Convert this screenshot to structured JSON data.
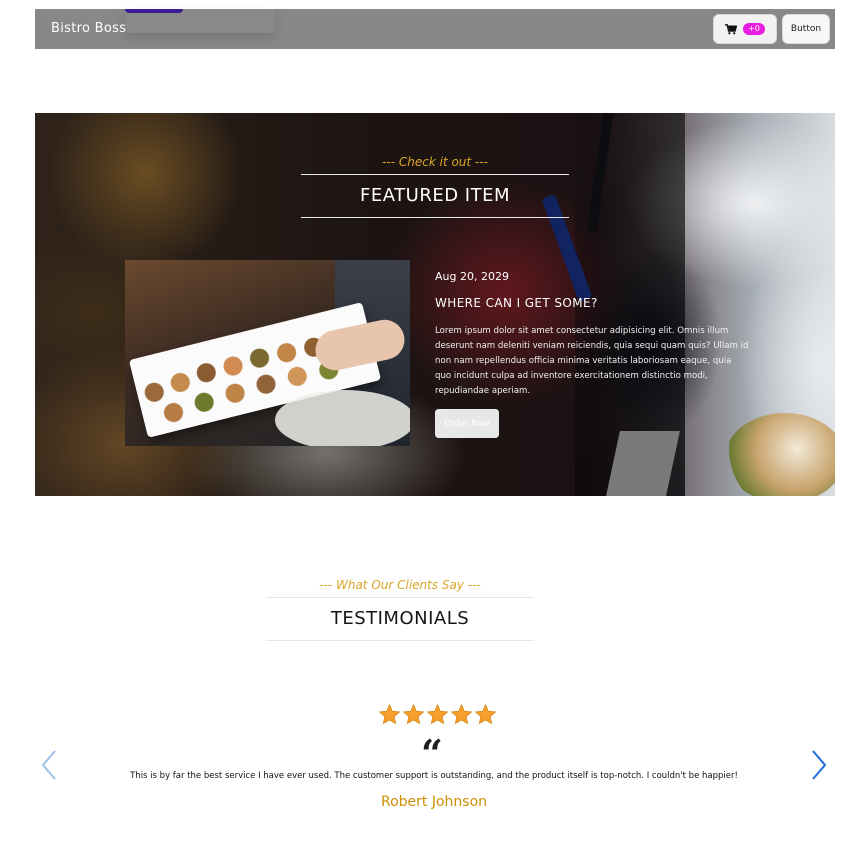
{
  "navbar": {
    "brand": "Bistro Boss",
    "cart_count": "+0",
    "button_label": "Button"
  },
  "featured": {
    "kicker": "--- Check it out ---",
    "title": "FEATURED ITEM",
    "date": "Aug 20, 2029",
    "question": "WHERE CAN I GET SOME?",
    "description": "Lorem ipsum dolor sit amet consectetur adipisicing elit. Omnis illum deserunt nam deleniti veniam reiciendis, quia sequi quam quis? Ullam id non nam repellendus officia minima veritatis laboriosam eaque, quia quo incidunt culpa ad inventore exercitationem distinctio modi, repudiandae aperiam.",
    "order_label": "Order Now"
  },
  "testimonials": {
    "kicker": "--- What Our Clients Say ---",
    "title": "TESTIMONIALS",
    "rating": 5,
    "rating_max": 5,
    "quote_icon": "quote-icon",
    "review": "This is by far the best service I have ever used. The customer support is outstanding, and the product itself is top-notch. I couldn't be happier!",
    "reviewer": "Robert Johnson"
  },
  "colors": {
    "accent_gold": "#D99904",
    "reviewer_name": "#CD9003",
    "badge_pink": "#E91EE0",
    "navbar_bg": "#888888",
    "arrow_blue": "#1E6FD9"
  }
}
